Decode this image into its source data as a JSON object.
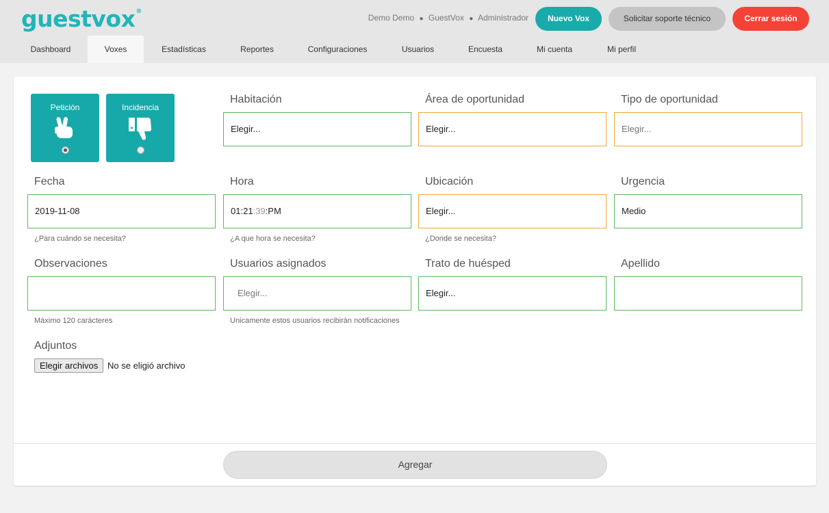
{
  "header": {
    "logo_text": "guestvox",
    "logo_mark": "®",
    "user": {
      "name": "Demo Demo",
      "account": "GuestVox",
      "role": "Administrador",
      "separator": "●"
    },
    "buttons": {
      "new_vox": "Nuevo Vox",
      "support": "Solicitar soporte técnico",
      "logout": "Cerrar sesión"
    },
    "colors": {
      "brand": "#22b5b8",
      "new_vox_bg": "#19aaaa",
      "support_bg": "#c4c4c4",
      "logout_bg": "#f44237"
    }
  },
  "tabs": [
    {
      "label": "Dashboard",
      "active": false
    },
    {
      "label": "Voxes",
      "active": true
    },
    {
      "label": "Estadísticas",
      "active": false
    },
    {
      "label": "Reportes",
      "active": false
    },
    {
      "label": "Configuraciones",
      "active": false
    },
    {
      "label": "Usuarios",
      "active": false
    },
    {
      "label": "Encuesta",
      "active": false
    },
    {
      "label": "Mi cuenta",
      "active": false
    },
    {
      "label": "Mi perfil",
      "active": false
    }
  ],
  "form": {
    "types": [
      {
        "label": "Petición",
        "icon": "peace-hand-icon",
        "selected": true
      },
      {
        "label": "Incidencia",
        "icon": "thumbs-down-icon",
        "selected": false
      }
    ],
    "fields": {
      "habitacion": {
        "label": "Habitación",
        "value": "Elegir...",
        "border_color": "#5cb85c"
      },
      "area": {
        "label": "Área de oportunidad",
        "value": "Elegir...",
        "border_color": "#f0a830"
      },
      "tipo": {
        "label": "Tipo de oportunidad",
        "value": "Elegir...",
        "border_color": "#f0a830"
      },
      "fecha": {
        "label": "Fecha",
        "value": "2019-11-08",
        "hint": "¿Para cuándo se necesita?"
      },
      "hora": {
        "label": "Hora",
        "hours": "01",
        "minutes": "21",
        "seconds": "39",
        "ampm": "PM",
        "hint": "¿A que hora se necesita?"
      },
      "ubicacion": {
        "label": "Ubicación",
        "value": "Elegir...",
        "hint": "¿Donde se necesita?"
      },
      "urgencia": {
        "label": "Urgencia",
        "value": "Medio"
      },
      "observaciones": {
        "label": "Observaciones",
        "value": "",
        "hint": "Máximo 120 carácteres"
      },
      "usuarios": {
        "label": "Usuarios asignados",
        "placeholder": "Elegir...",
        "hint": "Unicamente estos usuarios recibirán notificaciones"
      },
      "trato": {
        "label": "Trato de huésped",
        "value": "Elegir..."
      },
      "apellido": {
        "label": "Apellido",
        "value": ""
      }
    },
    "attachments": {
      "label": "Adjuntos",
      "button": "Elegir archivos",
      "status": "No se eligió archivo"
    },
    "submit": "Agregar"
  }
}
